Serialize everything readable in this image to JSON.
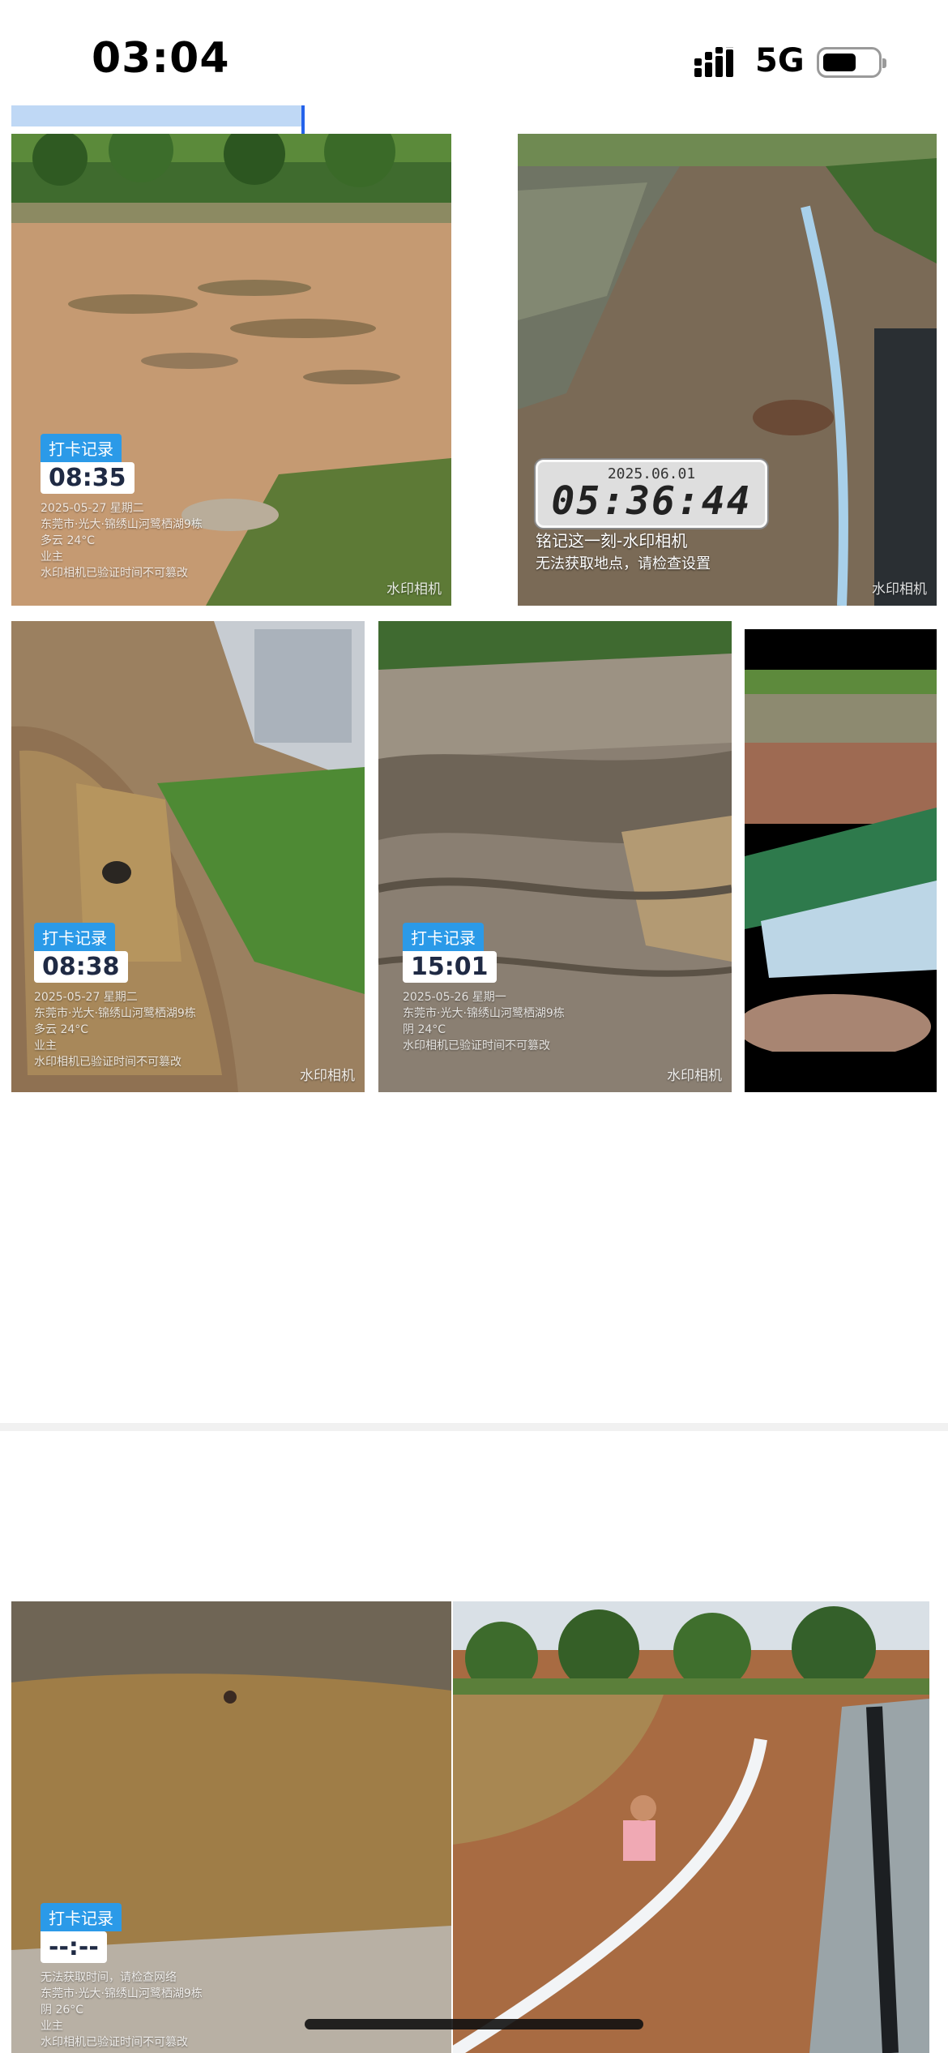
{
  "status_bar": {
    "time": "03:04",
    "network": "5G",
    "battery_icon": "battery-icon",
    "signal_icon": "signal-icon"
  },
  "photos": [
    {
      "stamp_tag": "打卡记录",
      "stamp_time": "08:35",
      "lines": [
        "2025-05-27 星期二",
        "东莞市·光大·锦绣山河鹭栖湖9栋",
        "多云 24°C",
        "业主",
        "水印相机已验证时间不可篡改"
      ],
      "brand": "水印相机"
    },
    {
      "lcd_date": "2025.06.01",
      "lcd_time": "05:36:44",
      "quote": "铭记这一刻-水印相机",
      "location": "无法获取地点，请检查设置",
      "brand": "水印相机"
    },
    {
      "stamp_tag": "打卡记录",
      "stamp_time": "08:38",
      "lines": [
        "2025-05-27 星期二",
        "东莞市·光大·锦绣山河鹭栖湖9栋",
        "多云 24°C",
        "业主",
        "水印相机已验证时间不可篡改"
      ],
      "brand": "水印相机"
    },
    {
      "stamp_tag": "打卡记录",
      "stamp_time": "15:01",
      "lines": [
        "2025-05-26 星期一",
        "东莞市·光大·锦绣山河鹭栖湖9栋",
        "阴 24°C",
        "",
        "水印相机已验证时间不可篡改"
      ],
      "brand": "水印相机"
    },
    {},
    {
      "stamp_tag": "打卡记录",
      "stamp_time": "--:--",
      "lines": [
        "无法获取时间，请检查网络",
        "东莞市·光大·锦绣山河鹭栖湖9栋",
        "阴 26°C",
        "业主",
        "水印相机已验证时间不可篡改"
      ]
    },
    {}
  ],
  "colors": {
    "accent": "#2563eb",
    "stamp_tag_bg": "#2b9ae8",
    "separator": "#f1f1f1"
  }
}
